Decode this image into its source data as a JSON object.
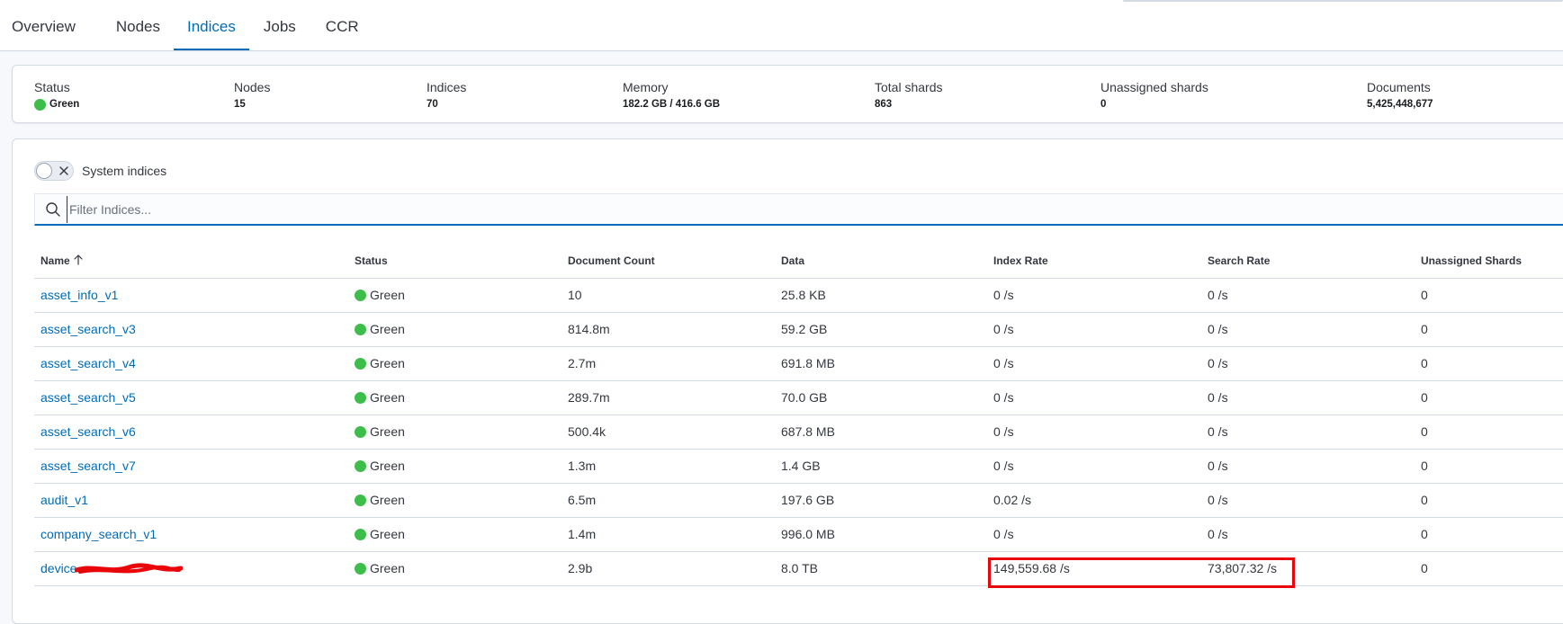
{
  "tabs": [
    {
      "label": "Overview",
      "active": false
    },
    {
      "label": "Nodes",
      "active": false
    },
    {
      "label": "Indices",
      "active": true
    },
    {
      "label": "Jobs",
      "active": false
    },
    {
      "label": "CCR",
      "active": false
    }
  ],
  "summary": {
    "status": {
      "label": "Status",
      "value": "Green"
    },
    "nodes": {
      "label": "Nodes",
      "value": "15"
    },
    "indices": {
      "label": "Indices",
      "value": "70"
    },
    "memory": {
      "label": "Memory",
      "value": "182.2 GB / 416.6 GB"
    },
    "total_shards": {
      "label": "Total shards",
      "value": "863"
    },
    "unassigned_shards": {
      "label": "Unassigned shards",
      "value": "0"
    },
    "documents": {
      "label": "Documents",
      "value": "5,425,448,677"
    }
  },
  "toggle": {
    "label": "System indices",
    "checked": false
  },
  "filter": {
    "placeholder": "Filter Indices..."
  },
  "table": {
    "columns": {
      "name": "Name",
      "status": "Status",
      "doc_count": "Document Count",
      "data": "Data",
      "index_rate": "Index Rate",
      "search_rate": "Search Rate",
      "unassigned_shards": "Unassigned Shards"
    },
    "rows": [
      {
        "name": "asset_info_v1",
        "status": "Green",
        "doc_count": "10",
        "data": "25.8 KB",
        "index_rate": "0 /s",
        "search_rate": "0 /s",
        "unassigned_shards": "0"
      },
      {
        "name": "asset_search_v3",
        "status": "Green",
        "doc_count": "814.8m",
        "data": "59.2 GB",
        "index_rate": "0 /s",
        "search_rate": "0 /s",
        "unassigned_shards": "0"
      },
      {
        "name": "asset_search_v4",
        "status": "Green",
        "doc_count": "2.7m",
        "data": "691.8 MB",
        "index_rate": "0 /s",
        "search_rate": "0 /s",
        "unassigned_shards": "0"
      },
      {
        "name": "asset_search_v5",
        "status": "Green",
        "doc_count": "289.7m",
        "data": "70.0 GB",
        "index_rate": "0 /s",
        "search_rate": "0 /s",
        "unassigned_shards": "0"
      },
      {
        "name": "asset_search_v6",
        "status": "Green",
        "doc_count": "500.4k",
        "data": "687.8 MB",
        "index_rate": "0 /s",
        "search_rate": "0 /s",
        "unassigned_shards": "0"
      },
      {
        "name": "asset_search_v7",
        "status": "Green",
        "doc_count": "1.3m",
        "data": "1.4 GB",
        "index_rate": "0 /s",
        "search_rate": "0 /s",
        "unassigned_shards": "0"
      },
      {
        "name": "audit_v1",
        "status": "Green",
        "doc_count": "6.5m",
        "data": "197.6 GB",
        "index_rate": "0.02 /s",
        "search_rate": "0 /s",
        "unassigned_shards": "0"
      },
      {
        "name": "company_search_v1",
        "status": "Green",
        "doc_count": "1.4m",
        "data": "996.0 MB",
        "index_rate": "0 /s",
        "search_rate": "0 /s",
        "unassigned_shards": "0"
      },
      {
        "name": "device",
        "status": "Green",
        "doc_count": "2.9b",
        "data": "8.0 TB",
        "index_rate": "149,559.68 /s",
        "search_rate": "73,807.32 /s",
        "unassigned_shards": "0"
      }
    ]
  },
  "colors": {
    "accent": "#006bb8",
    "status_green": "#3dbd4a",
    "highlight": "#e8060a"
  },
  "icons": {
    "search": "search-icon",
    "sort": "arrow-up-icon",
    "toggle_off": "close-icon",
    "status": "status-dot-icon"
  }
}
